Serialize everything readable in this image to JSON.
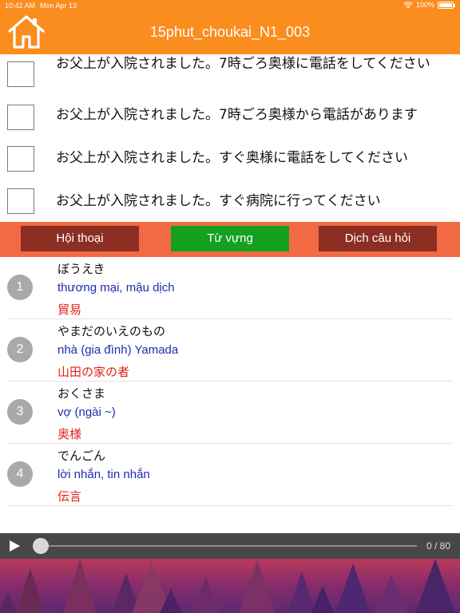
{
  "status_bar": {
    "time": "10:42 AM",
    "date": "Mon Apr 13",
    "battery": "100%"
  },
  "header": {
    "title": "15phut_choukai_N1_003",
    "home_icon": "home-icon",
    "background": "#fb8c1e"
  },
  "options": [
    {
      "text": "お父上が入院されました。7時ごろ奥様に電話をしてください",
      "checked": false
    },
    {
      "text": "お父上が入院されました。7時ごろ奥様から電話があります",
      "checked": false
    },
    {
      "text": "お父上が入院されました。すぐ奥様に電話をしてください",
      "checked": false
    },
    {
      "text": "お父上が入院されました。すぐ病院に行ってください",
      "checked": false
    }
  ],
  "tabs": [
    {
      "label": "Hội thoại",
      "active": false
    },
    {
      "label": "Từ vựng",
      "active": true
    },
    {
      "label": "Dịch câu hỏi",
      "active": false
    }
  ],
  "vocabulary": [
    {
      "number": "1",
      "kana": "ぼうえき",
      "meaning": "thương mại, mậu dịch",
      "kanji": "貿易"
    },
    {
      "number": "2",
      "kana": "やまだのいえのもの",
      "meaning": "nhà (gia đình) Yamada",
      "kanji": "山田の家の者"
    },
    {
      "number": "3",
      "kana": "おくさま",
      "meaning": "vợ (ngài ~)",
      "kanji": "奥様"
    },
    {
      "number": "4",
      "kana": "でんごん",
      "meaning": "lời nhắn, tin nhắn",
      "kanji": "伝言"
    }
  ],
  "player": {
    "counter": "0 / 80",
    "progress": 0,
    "play_icon": "play-icon"
  },
  "colors": {
    "accent": "#fb8c1e",
    "tab_bar": "#f26a44",
    "tab_dark": "#8c2e22",
    "tab_active": "#12a01e",
    "meaning": "#1f2bb0",
    "kanji": "#e0201a"
  }
}
